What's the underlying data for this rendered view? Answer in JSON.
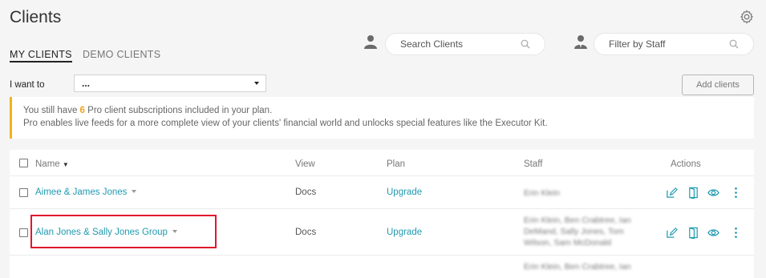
{
  "page": {
    "title": "Clients"
  },
  "tabs": [
    {
      "label": "MY CLIENTS",
      "active": true
    },
    {
      "label": "DEMO CLIENTS",
      "active": false
    }
  ],
  "search": {
    "placeholder": "Search Clients",
    "icon": "search-icon"
  },
  "staff_filter": {
    "placeholder": "Filter by Staff",
    "icon": "search-icon"
  },
  "toolbar": {
    "i_want_to_label": "I want to",
    "action_select_value": "...",
    "add_clients_label": "Add clients"
  },
  "notice": {
    "line1_prefix": "You still have ",
    "count": "6",
    "line1_suffix": " Pro client subscriptions included in your plan.",
    "line2": "Pro enables live feeds for a more complete view of your clients' financial world and unlocks special features like the Executor Kit.",
    "accent_color": "#f3b21a"
  },
  "table": {
    "columns": {
      "name": "Name",
      "view": "View",
      "plan": "Plan",
      "staff": "Staff",
      "actions": "Actions"
    },
    "rows": [
      {
        "name": "Aimee & James Jones",
        "view": "Docs",
        "plan": "Upgrade",
        "staff": "Erin Klein"
      },
      {
        "name": "Alan Jones & Sally Jones Group",
        "view": "Docs",
        "plan": "Upgrade",
        "staff_lines": [
          "Erin Klein, Ben Crabtree, Ian",
          "DeMand, Sally Jones, Tom",
          "Wilson, Sam McDonald"
        ]
      },
      {
        "staff": "Erin Klein, Ben Crabtree, Ian"
      }
    ]
  },
  "colors": {
    "link": "#1f9ab0",
    "highlight": "#e0182d",
    "accent": "#f3b21a"
  }
}
